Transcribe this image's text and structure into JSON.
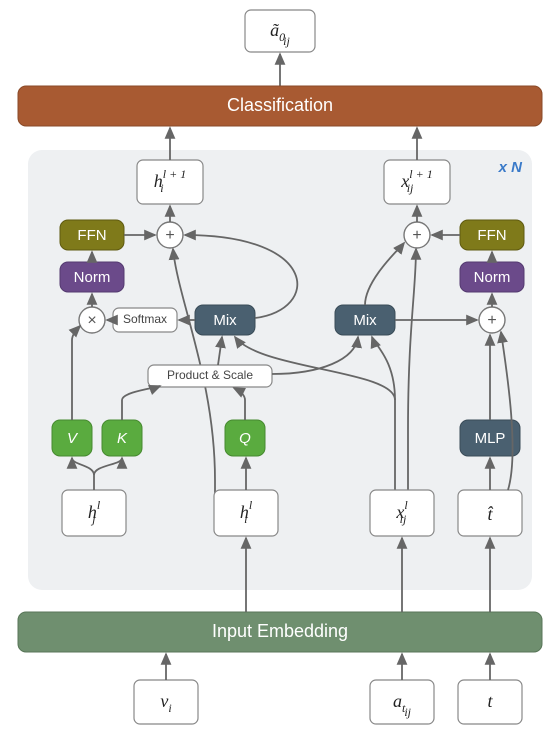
{
  "output": {
    "label": "ã",
    "sub": "0",
    "subsub": "ij"
  },
  "classification": {
    "label": "Classification"
  },
  "inputEmbedding": {
    "label": "Input Embedding"
  },
  "multiplier": "x N",
  "layerBlock": {
    "leftOut": {
      "base": "h",
      "sub": "i",
      "sup": "l + 1"
    },
    "rightOut": {
      "base": "x",
      "sub": "ij",
      "sup": "l + 1"
    },
    "ffnL": "FFN",
    "ffnR": "FFN",
    "normL": "Norm",
    "normR": "Norm",
    "softmax": "Softmax",
    "mixL": "Mix",
    "mixR": "Mix",
    "prodScale": "Product & Scale",
    "V": "V",
    "K": "K",
    "Q": "Q",
    "MLP": "MLP",
    "hjl": {
      "base": "h",
      "sub": "j",
      "sup": "l"
    },
    "hil": {
      "base": "h",
      "sub": "i",
      "sup": "l"
    },
    "xijl": {
      "base": "x",
      "sub": "ij",
      "sup": "l"
    },
    "that": {
      "base": "t̂"
    }
  },
  "inputs": {
    "vi": {
      "base": "v",
      "sub": "i"
    },
    "atij": {
      "base": "a",
      "sub": "t",
      "subsub": "ij"
    },
    "t": {
      "base": "t"
    }
  },
  "colors": {
    "classification": "#a85a32",
    "embedding": "#6f8f6f",
    "ffn": "#7f7a1a",
    "norm": "#6b4a8a",
    "mix": "#4a6070",
    "qkv": "#5aab3f",
    "mlp": "#4a6070",
    "blockBg": "#eef0f2"
  }
}
